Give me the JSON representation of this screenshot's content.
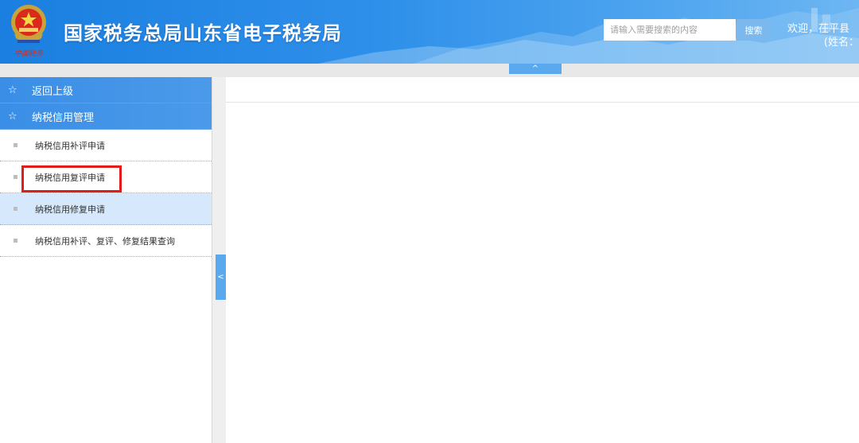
{
  "header": {
    "title": "国家税务总局山东省电子税务局",
    "emblem_caption": "中国税务",
    "search_placeholder": "请输入需要搜索的内容",
    "search_label": "搜索",
    "welcome_line1": "欢迎，茌平县",
    "welcome_line2": "(姓名："
  },
  "controls": {
    "collapse_top_glyph": "^",
    "collapse_side_glyph": "<"
  },
  "sidebar": {
    "back_label": "返回上级",
    "section_label": "纳税信用管理",
    "items": [
      {
        "label": "纳税信用补评申请"
      },
      {
        "label": "纳税信用复评申请"
      },
      {
        "label": "纳税信用修复申请"
      },
      {
        "label": "纳税信用补评、复评、修复结果查询"
      }
    ]
  },
  "colors": {
    "header_blue": "#1a7fe0",
    "sidebar_head": "#3a8ee6",
    "active_row": "#d6e8fb",
    "highlight_red": "#e21b1b"
  },
  "icons": [
    "emblem-logo",
    "star-icon",
    "bullet-icon",
    "chevron-up-icon",
    "chevron-left-icon"
  ]
}
